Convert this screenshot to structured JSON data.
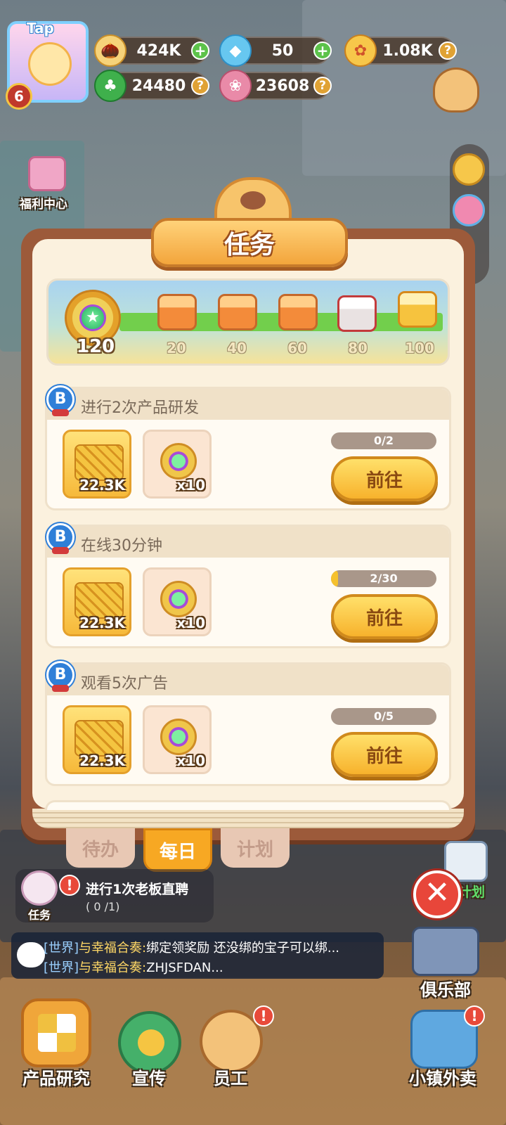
{
  "hud": {
    "tag": "Tap",
    "level": "6",
    "seeds": "424K",
    "gems": "50",
    "flowers": "1.08K",
    "clovers": "24480",
    "petals": "23608",
    "plus": "+",
    "help": "?"
  },
  "left_menu": {
    "welfare_center": "福利中心"
  },
  "panel": {
    "title": "任务",
    "progress": {
      "current": "120",
      "milestones": [
        "20",
        "40",
        "60",
        "80",
        "100"
      ]
    },
    "tasks": [
      {
        "badge": "B",
        "title": "进行2次产品研发",
        "reward_seeds": "22.3K",
        "reward_tokens": "x10",
        "progress_text": "0/2",
        "progress": 0,
        "button": "前往"
      },
      {
        "badge": "B",
        "title": "在线30分钟",
        "reward_seeds": "22.3K",
        "reward_tokens": "x10",
        "progress_text": "2/30",
        "progress": 0.067,
        "button": "前往"
      },
      {
        "badge": "B",
        "title": "观看5次广告",
        "reward_seeds": "22.3K",
        "reward_tokens": "x10",
        "progress_text": "0/5",
        "progress": 0,
        "button": "前往"
      }
    ],
    "tabs": [
      {
        "label": "待办",
        "active": false
      },
      {
        "label": "每日",
        "active": true
      },
      {
        "label": "计划",
        "active": false
      }
    ]
  },
  "quest_tracker": {
    "label": "任务",
    "text": "进行1次老板直聘",
    "progress": "( 0 /1)"
  },
  "plan_label": "计划",
  "close_symbol": "✕",
  "chat": {
    "lines": [
      {
        "channel": "[世界]",
        "name": "与幸福合奏:",
        "text": "绑定领奖励 还没绑的宝子可以绑..."
      },
      {
        "channel": "[世界]",
        "name": "与幸福合奏:",
        "text": "ZHJSFDAN..."
      }
    ]
  },
  "bottom_nav": [
    {
      "label": "产品研究"
    },
    {
      "label": "宣传"
    },
    {
      "label": "员工"
    }
  ],
  "right_nav": {
    "club": "俱乐部",
    "delivery": "小镇外卖"
  },
  "notice_mark": "!",
  "icons": [
    "avatar-icon",
    "seed-icon",
    "gem-icon",
    "flower-icon",
    "clover-icon",
    "petal-icon",
    "trophy-icon",
    "balloon-icon",
    "chest-icon",
    "chat-icon",
    "close-icon"
  ],
  "colors": {
    "accent": "#f7b22c",
    "panel_border": "#9c5a3a",
    "progress_green": "#72cf4c",
    "badge_blue": "#2f7fd8"
  }
}
